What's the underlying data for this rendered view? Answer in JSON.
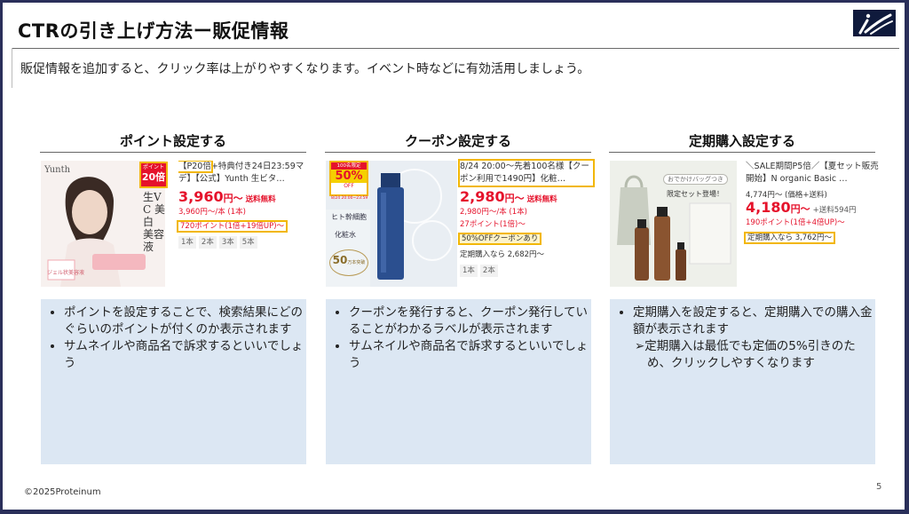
{
  "slide": {
    "title": "CTRの引き上げ方法ー販促情報",
    "subtitle": "販促情報を追加すると、クリック率は上がりやすくなります。イベント時などに有効活用しましょう。",
    "footer": "©2025Proteinum",
    "page_number": "5"
  },
  "columns": [
    {
      "heading": "ポイント設定する",
      "image": {
        "brand": "Yunth",
        "badge_top": "ポイント",
        "badge_num": "20倍",
        "vertical_text": "生VC 美白 美容液",
        "small_note": "ジェル状美容液"
      },
      "product": {
        "title_hl": "【P20倍",
        "title_rest": "+特典付き24日23:59マデ】【公式】Yunth 生ビタ…",
        "price": "3,960",
        "price_suffix": "円～",
        "shipping": "送料無料",
        "unit": "3,960円～/本 (1本)",
        "points": "720ポイント(1倍+19倍UP)～",
        "tags": [
          "1本",
          "2本",
          "3本",
          "5本"
        ]
      },
      "bullets": [
        "ポイントを設定することで、検索結果にどのぐらいのポイントが付くのか表示されます",
        "サムネイルや商品名で訴求するといいでしょう"
      ]
    },
    {
      "heading": "クーポン設定する",
      "image": {
        "badge_top": "100名限定",
        "badge_num": "50%",
        "badge_off": "OFF",
        "badge_date": "8/24 20:00~23:59",
        "bottle_text1": "ヒト幹細胞",
        "bottle_text2": "化粧水",
        "seal_num": "50",
        "seal_text": "万本突破"
      },
      "product": {
        "title_hl": "8/24 20:00～先着100名様【クーポン利用で1490円】化粧…",
        "price": "2,980",
        "price_suffix": "円～",
        "shipping": "送料無料",
        "unit": "2,980円～/本 (1本)",
        "points": "27ポイント(1倍)～",
        "coupon": "50%OFFクーポンあり",
        "subscription": "定期購入なら 2,682円～",
        "tags": [
          "1本",
          "2本"
        ]
      },
      "bullets": [
        "クーポンを発行すると、クーポン発行していることがわかるラベルが表示されます",
        "サムネイルや商品名で訴求するといいでしょう"
      ]
    },
    {
      "heading": "定期購入設定する",
      "image": {
        "bag_label": "おでかけバッグつき",
        "set_label": "限定セット登場！"
      },
      "product": {
        "title": "＼SALE期間P5倍／【夏セット販売開始】N organic Basic …",
        "price_from": "4,774円～ (価格+送料)",
        "price": "4,180",
        "price_suffix": "円～",
        "shipping": "+送料594円",
        "points": "190ポイント(1倍+4倍UP)～",
        "subscription": "定期購入なら 3,762円～"
      },
      "bullets": [
        "定期購入を設定すると、定期購入での購入金額が表示されます"
      ],
      "sub_bullet": "➢定期購入は最低でも定価の5%引きのため、クリックしやすくなります"
    }
  ],
  "colors": {
    "accent_yellow": "#f2b705",
    "price_red": "#e5122b",
    "panel_blue": "#dce7f3",
    "frame": "#2a2f5a"
  }
}
